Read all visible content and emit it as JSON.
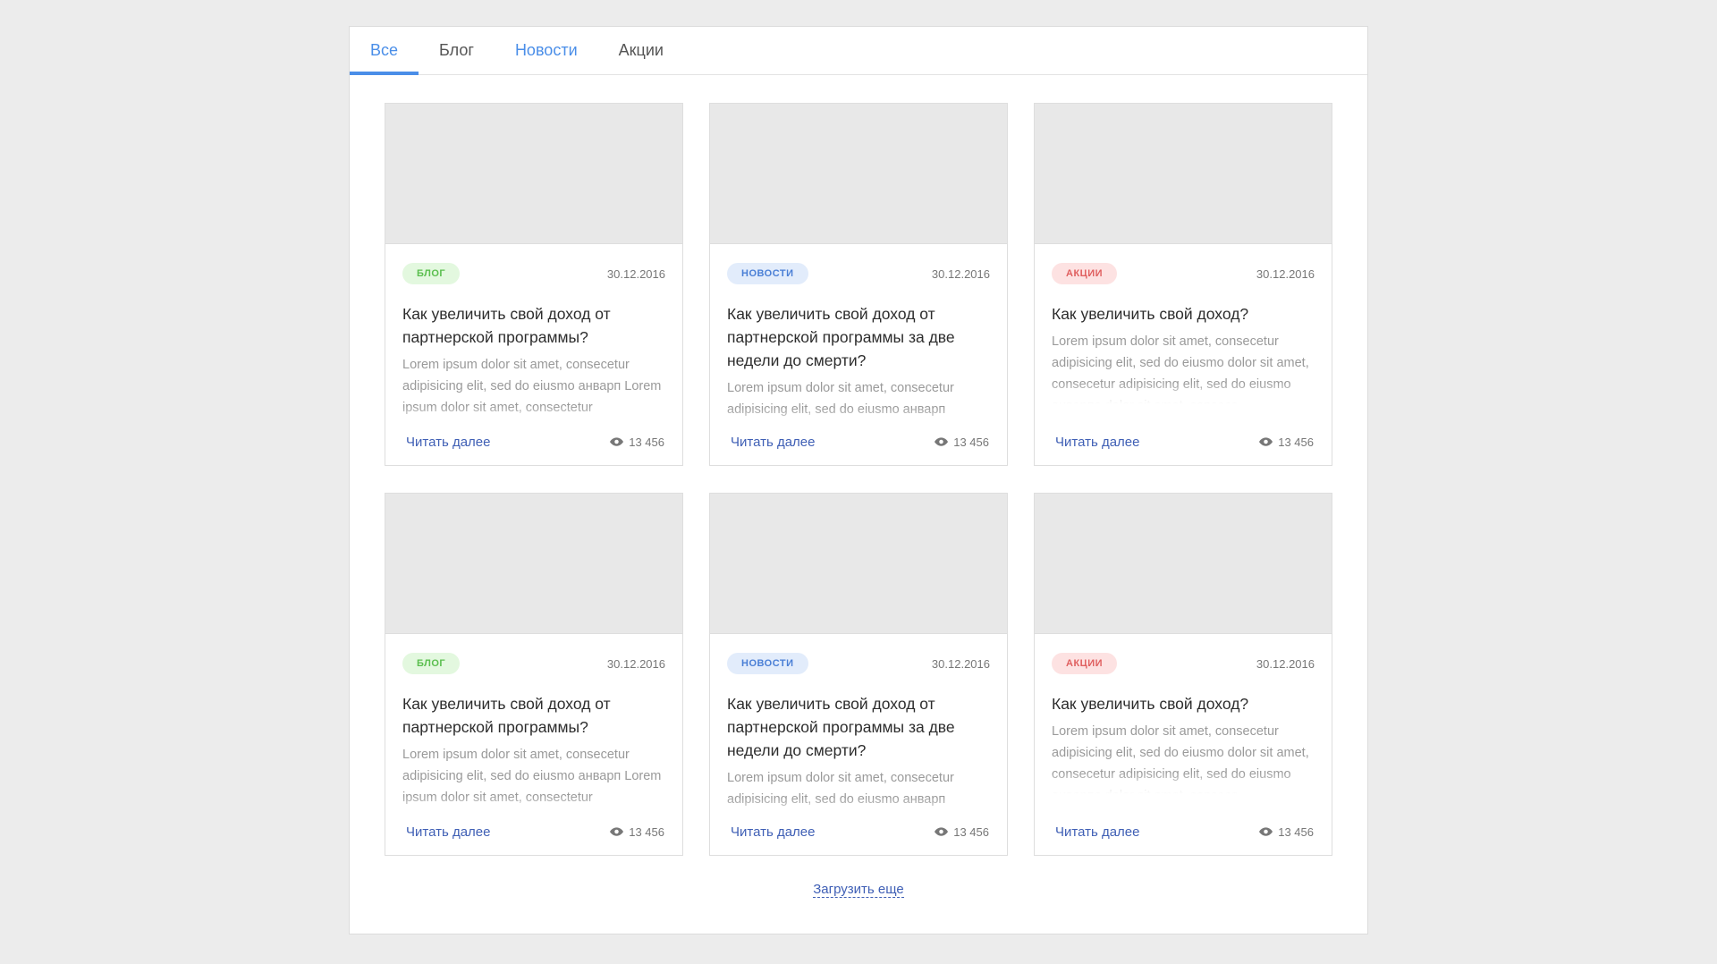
{
  "tabs": [
    {
      "label": "Все",
      "state": "active"
    },
    {
      "label": "Блог",
      "state": "normal"
    },
    {
      "label": "Новости",
      "state": "highlight"
    },
    {
      "label": "Акции",
      "state": "normal"
    }
  ],
  "colors": {
    "accent": "#4a8ee8",
    "link": "#3f5fb5",
    "blog_badge_bg": "#e3f8df",
    "news_badge_bg": "#e2ecfb",
    "promo_badge_bg": "#fde2e2"
  },
  "cards": [
    {
      "category": "блог",
      "date": "30.12.2016",
      "title": "Как увеличить свой доход от партнерской программы?",
      "excerpt": "Lorem ipsum dolor sit amet, consecetur adipisicing elit, sed do eiusmo анварп Lorem ipsum dolor sit amet, consectetur",
      "read_more": "Читать далее",
      "views": "13 456"
    },
    {
      "category": "новости",
      "date": "30.12.2016",
      "title": "Как увеличить свой доход от партнерской программы за две недели до смерти?",
      "excerpt": "Lorem ipsum dolor sit amet, consecetur adipisicing elit, sed do eiusmo анварп",
      "read_more": "Читать далее",
      "views": "13 456"
    },
    {
      "category": "акции",
      "date": "30.12.2016",
      "title": "Как увеличить свой доход?",
      "excerpt": "Lorem ipsum dolor sit amet, consecetur adipisicing elit, sed do eiusmo dolor sit amet, consecetur adipisicing elit, sed do eiusmo анварпа dolor sit amet, consece-",
      "read_more": "Читать далее",
      "views": "13 456"
    },
    {
      "category": "блог",
      "date": "30.12.2016",
      "title": "Как увеличить свой доход от партнерской программы?",
      "excerpt": "Lorem ipsum dolor sit amet, consecetur adipisicing elit, sed do eiusmo анварп Lorem ipsum dolor sit amet, consectetur",
      "read_more": "Читать далее",
      "views": "13 456"
    },
    {
      "category": "новости",
      "date": "30.12.2016",
      "title": "Как увеличить свой доход от партнерской программы за две недели до смерти?",
      "excerpt": "Lorem ipsum dolor sit amet, consecetur adipisicing elit, sed do eiusmo анварп",
      "read_more": "Читать далее",
      "views": "13 456"
    },
    {
      "category": "акции",
      "date": "30.12.2016",
      "title": "Как увеличить свой доход?",
      "excerpt": "Lorem ipsum dolor sit amet, consecetur adipisicing elit, sed do eiusmo dolor sit amet, consecetur adipisicing elit, sed do eiusmo анварпа dolor sit amet, consece-",
      "read_more": "Читать далее",
      "views": "13 456"
    }
  ],
  "load_more": "Загрузить еще"
}
